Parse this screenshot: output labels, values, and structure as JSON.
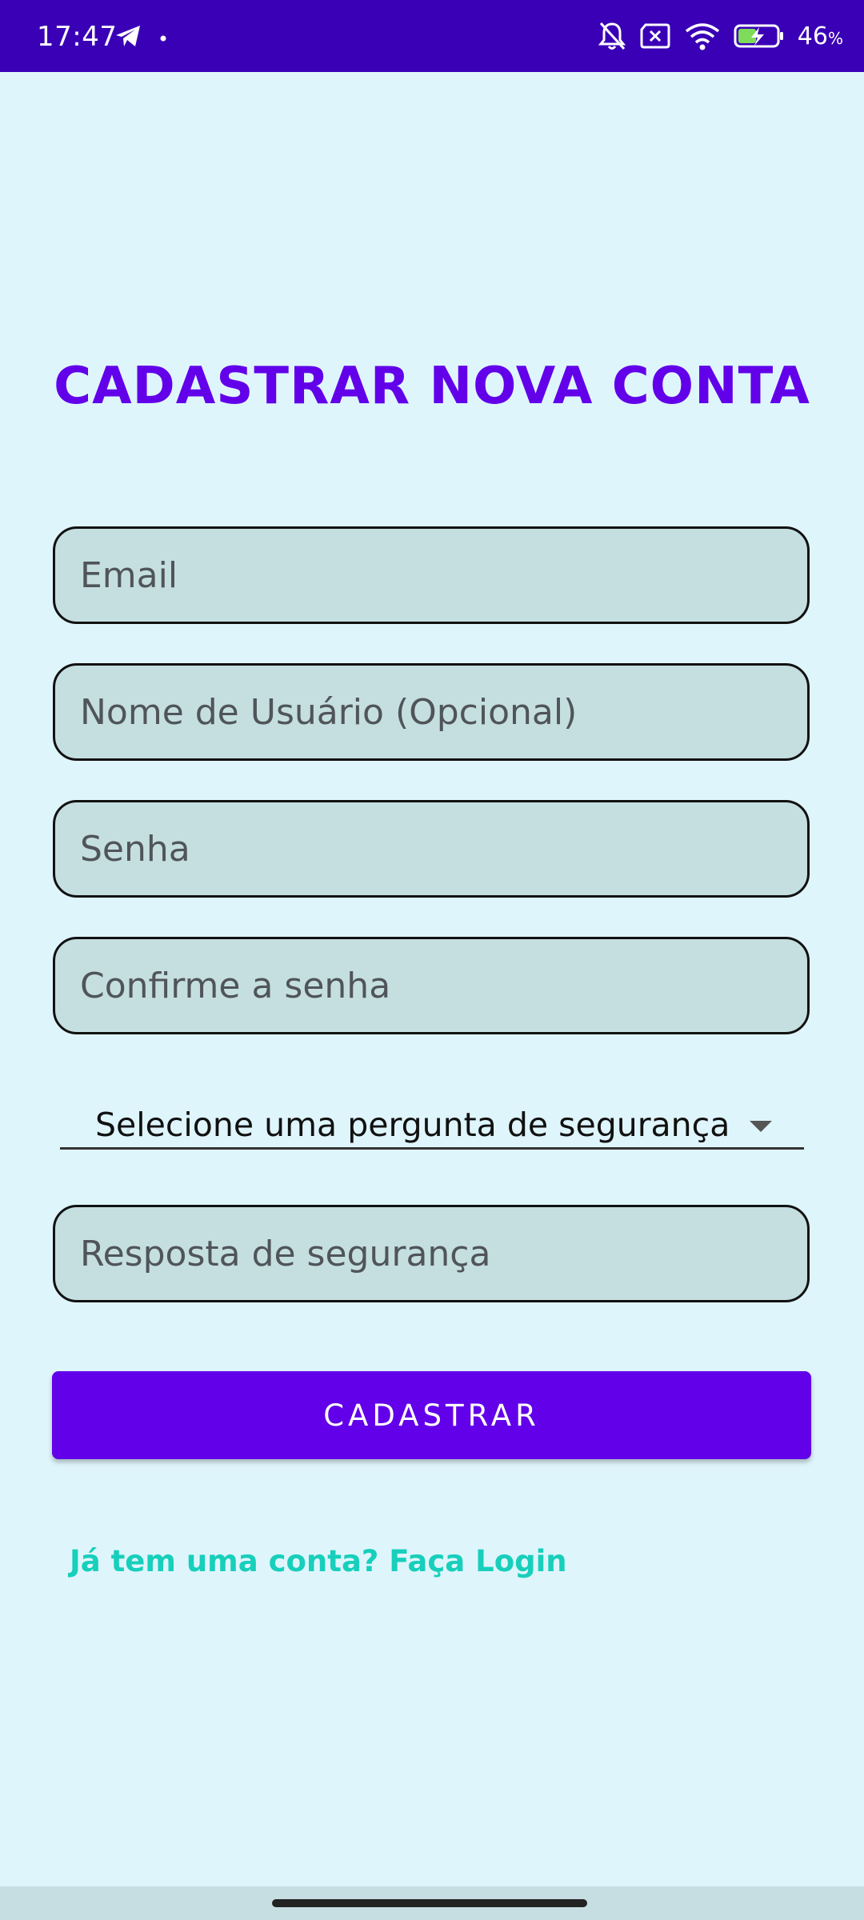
{
  "status_bar": {
    "time": "17:47",
    "battery_percent": "46",
    "battery_percent_symbol": "%",
    "icons": [
      "telegram-icon",
      "dot-icon",
      "bell-off-icon",
      "sim-off-icon",
      "wifi-icon",
      "battery-charging-icon"
    ]
  },
  "screen": {
    "title": "CADASTRAR NOVA CONTA"
  },
  "form": {
    "email_placeholder": "Email",
    "username_placeholder": "Nome de Usuário (Opcional)",
    "password_placeholder": "Senha",
    "confirm_password_placeholder": "Confirme a senha",
    "security_question_selected": "Selecione uma pergunta de segurança",
    "security_answer_placeholder": "Resposta de segurança",
    "submit_label": "CADASTRAR",
    "login_link": "Já tem uma conta? Faça Login"
  },
  "colors": {
    "status_bar": "#3a00b6",
    "background": "#dff5fc",
    "accent": "#6200ea",
    "link": "#17cfbb",
    "field_fill": "#c5dfe1"
  }
}
